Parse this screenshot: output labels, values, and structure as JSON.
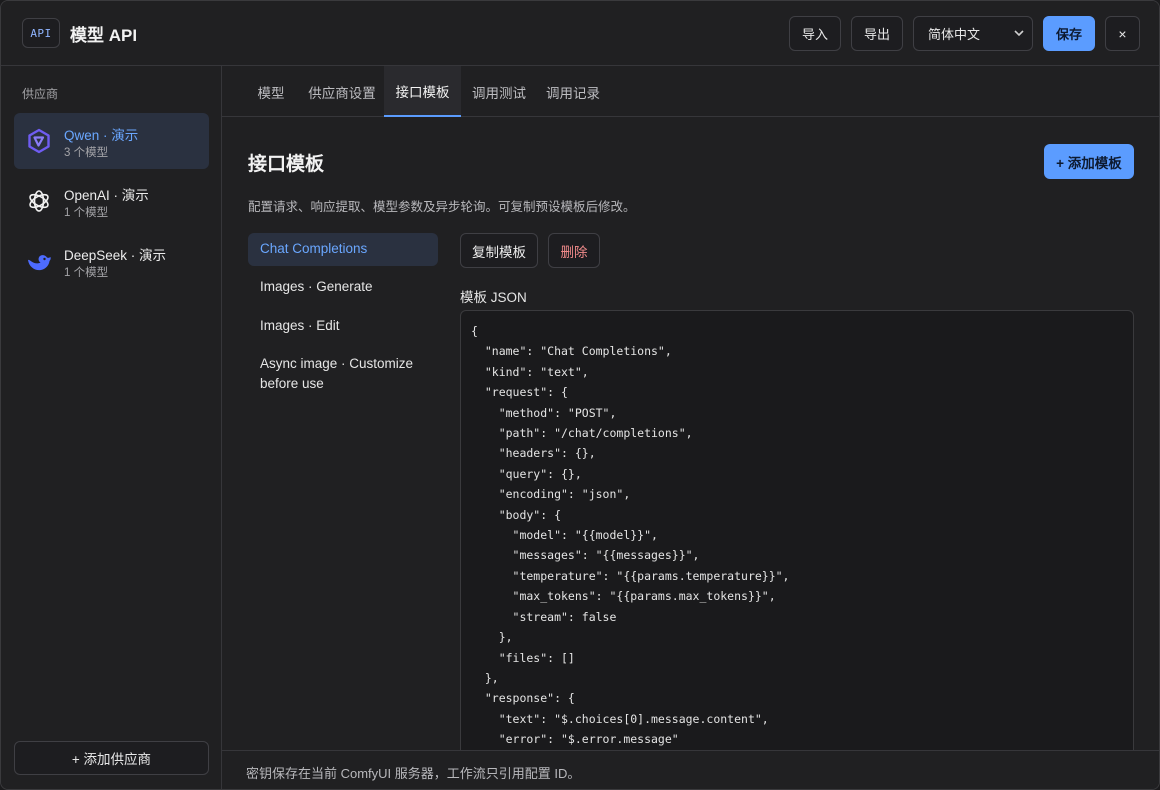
{
  "header": {
    "badge": "API",
    "title": "模型 API",
    "import_label": "导入",
    "export_label": "导出",
    "language": "简体中文",
    "save_label": "保存",
    "close_label": "×"
  },
  "sidebar": {
    "section_label": "供应商",
    "providers": [
      {
        "name": "Qwen · 演示",
        "count": "3 个模型",
        "icon": "qwen-logo-icon",
        "color": "#6f5cf2"
      },
      {
        "name": "OpenAI · 演示",
        "count": "1 个模型",
        "icon": "openai-logo-icon",
        "color": "#ffffff"
      },
      {
        "name": "DeepSeek · 演示",
        "count": "1 个模型",
        "icon": "deepseek-logo-icon",
        "color": "#4d6bfe"
      }
    ],
    "add_label": "+ 添加供应商"
  },
  "tabs": [
    "模型",
    "供应商设置",
    "接口模板",
    "调用测试",
    "调用记录"
  ],
  "active_tab": "接口模板",
  "content": {
    "title": "接口模板",
    "add_label": "+ 添加模板",
    "description": "配置请求、响应提取、模型参数及异步轮询。可复制预设模板后修改。",
    "templates": [
      "Chat Completions",
      "Images · Generate",
      "Images · Edit",
      "Async image · Customize before use"
    ],
    "copy_label": "复制模板",
    "delete_label": "删除",
    "json_label": "模板 JSON",
    "json_text": "{\n  \"name\": \"Chat Completions\",\n  \"kind\": \"text\",\n  \"request\": {\n    \"method\": \"POST\",\n    \"path\": \"/chat/completions\",\n    \"headers\": {},\n    \"query\": {},\n    \"encoding\": \"json\",\n    \"body\": {\n      \"model\": \"{{model}}\",\n      \"messages\": \"{{messages}}\",\n      \"temperature\": \"{{params.temperature}}\",\n      \"max_tokens\": \"{{params.max_tokens}}\",\n      \"stream\": false\n    },\n    \"files\": []\n  },\n  \"response\": {\n    \"text\": \"$.choices[0].message.content\",\n    \"error\": \"$.error.message\""
  },
  "footer": {
    "text": "密钥保存在当前 ComfyUI 服务器，工作流只引用配置 ID。"
  },
  "colors": {
    "accent": "#5b9cff",
    "danger": "#f08a8a",
    "background": "#202022"
  }
}
